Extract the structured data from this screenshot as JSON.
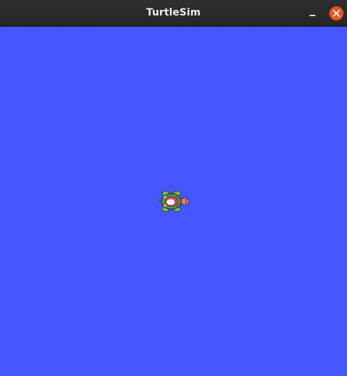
{
  "window": {
    "title": "TurtleSim",
    "accent_close": "#e95420",
    "titlebar_color": "#2b2b2b"
  },
  "titlebar": {
    "minimize_icon": "minimize-icon",
    "close_icon": "close-icon"
  },
  "canvas": {
    "background_color": "#4556ff",
    "turtle_icon": "turtle-icon"
  }
}
